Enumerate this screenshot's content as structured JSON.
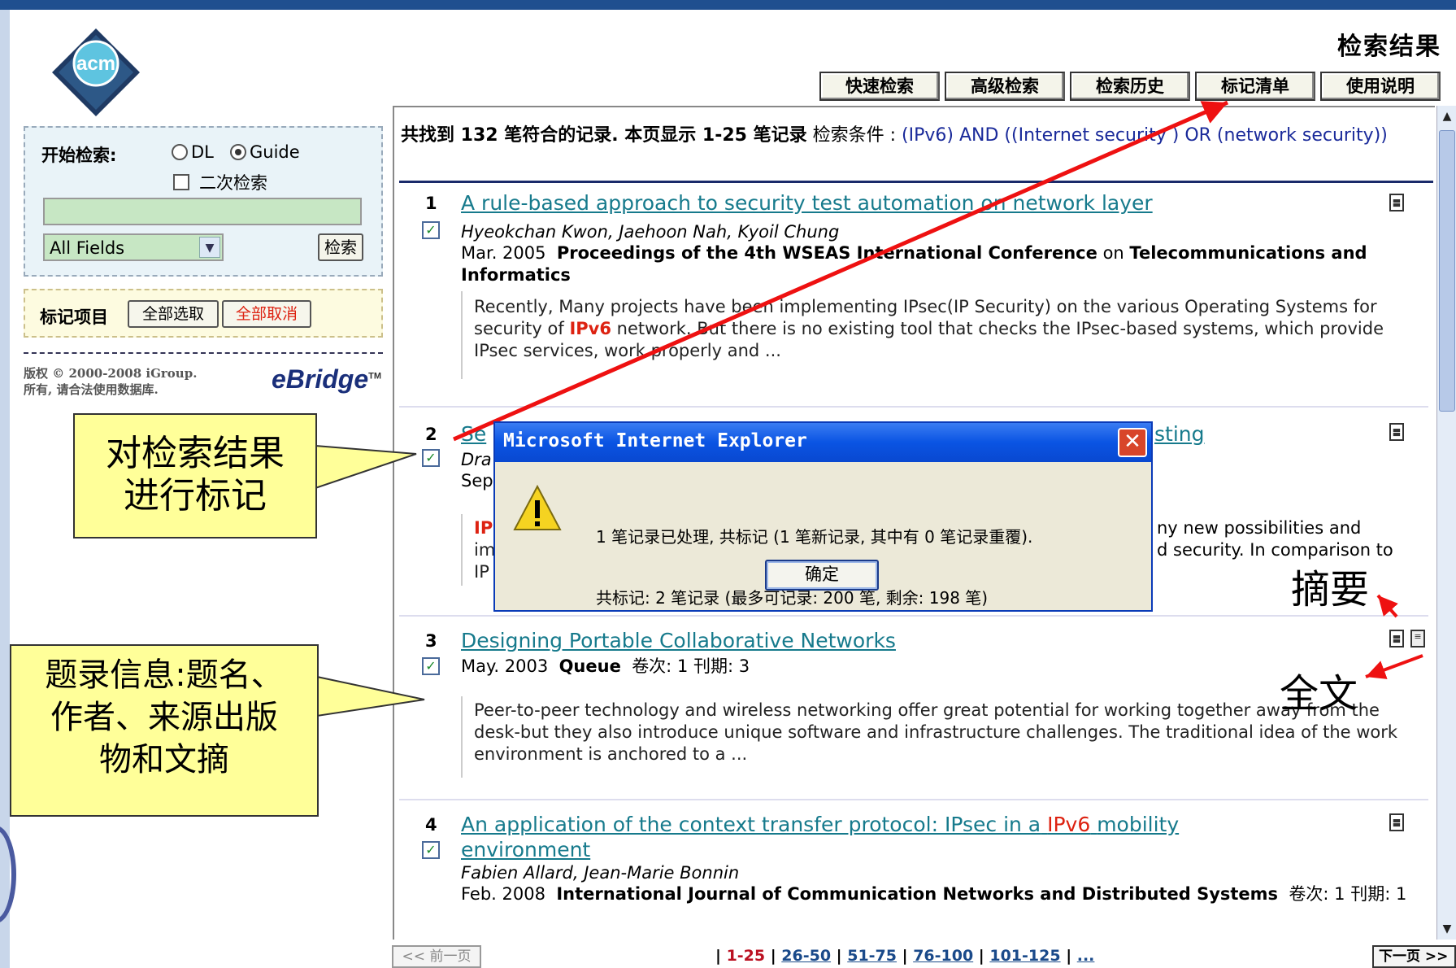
{
  "header": {
    "page_heading": "检索结果",
    "nav": [
      "快速检索",
      "高级检索",
      "检索历史",
      "标记清单",
      "使用说明"
    ],
    "logo_text": "acm"
  },
  "search_panel": {
    "title": "开始检索:",
    "options": {
      "dl": "DL",
      "guide": "Guide",
      "selected": "Guide"
    },
    "secondary_label": "二次检索",
    "input_value": "",
    "field_select": "All Fields",
    "search_button": "检索"
  },
  "mark_panel": {
    "label": "标记项目",
    "select_all": "全部选取",
    "cancel_all": "全部取消"
  },
  "footer_left": {
    "copyright_line1": "版权 © 2000-2008 iGroup.",
    "copyright_line2": "所有, 请合法使用数据库.",
    "brand": "eBridge",
    "brand_tm": "TM"
  },
  "summary": {
    "found_text": "共找到 132 笔符合的记录. 本页显示 1-25 笔记录",
    "criteria_label": "检索条件 :",
    "query": "(IPv6) AND ((Internet security ) OR (network security))"
  },
  "records": [
    {
      "num": "1",
      "title": "A rule-based approach to security test automation on network layer",
      "authors": "Hyeokchan Kwon, Jaehoon Nah, Kyoil Chung",
      "date": "Mar. 2005",
      "source_bold1": "Proceedings of the 4th WSEAS International Conference",
      "source_mid": "on",
      "source_bold2": "Telecommunications and Informatics",
      "abstract": "Recently, Many projects have been implementing IPsec(IP Security) on the various Operating Systems for security of IPv6 network. But there is no existing tool that checks the IPsec-based systems, which provide IPsec services, work properly and ..."
    },
    {
      "num": "2",
      "title_start": "Se",
      "title_end": "sting",
      "authors_start": "Dra",
      "date_start": "Sep",
      "abs_l1_start": "IP",
      "abs_l1_end": "ny new possibilities and",
      "abs_l2_start": "im",
      "abs_l2_end": "d security. In comparison to",
      "abs_l3_start": "IP"
    },
    {
      "num": "3",
      "title": "Designing Portable Collaborative Networks",
      "date": "May. 2003",
      "source": "Queue",
      "volume": "卷次: 1",
      "issue": "刊期: 3",
      "abstract": "Peer-to-peer technology and wireless networking offer great potential for working together away from the desk-but they also introduce unique software and infrastructure challenges. The traditional idea of the work environment is anchored to a ..."
    },
    {
      "num": "4",
      "title_part1": "An application of the context transfer protocol: IPsec in a",
      "title_hl": "IPv6",
      "title_part2": "mobility environment",
      "authors": "Fabien Allard, Jean-Marie Bonnin",
      "date": "Feb. 2008",
      "source": "International Journal of Communication Networks and Distributed Systems",
      "volume": "卷次: 1",
      "issue": "刊期: 1"
    }
  ],
  "pager": {
    "prev": "<< 前一页",
    "pages": [
      "1-25",
      "26-50",
      "51-75",
      "76-100",
      "101-125",
      "..."
    ],
    "next": "下一页 >>"
  },
  "dialog": {
    "title": "Microsoft Internet Explorer",
    "message_line1": "1 笔记录已处理, 共标记 (1 笔新记录, 其中有 0 笔记录重覆).",
    "message_line2": "共标记: 2 笔记录 (最多可记录: 200 笔, 剩余: 198 笔)",
    "ok": "确定"
  },
  "annotations": {
    "callout1": [
      "对检索结果",
      "进行标记"
    ],
    "callout2": [
      "题录信息:题名、",
      "作者、来源出版",
      "物和文摘"
    ],
    "abstract_label": "摘要",
    "fulltext_label": "全文"
  },
  "colors": {
    "title_link": "#167a8c",
    "highlight": "#dd2211",
    "dialog_title": "#0a54e3",
    "callout_fill": "#ffff99",
    "arrow": "#ee1111"
  }
}
